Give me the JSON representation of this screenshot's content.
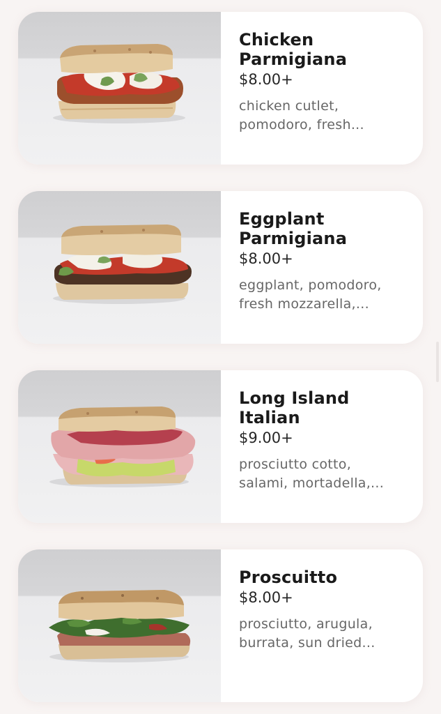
{
  "menu": {
    "items": [
      {
        "name": "Chicken Parmigiana",
        "name_lines": [
          "Chicken",
          "Parmigiana"
        ],
        "price": "$8.00+",
        "desc_lines": [
          "chicken cutlet,",
          "pomodoro, fresh..."
        ]
      },
      {
        "name": "Eggplant Parmigiana",
        "name_lines": [
          "Eggplant",
          "Parmigiana"
        ],
        "price": "$8.00+",
        "desc_lines": [
          "eggplant, pomodoro,",
          "fresh mozzarella,..."
        ]
      },
      {
        "name": "Long Island Italian",
        "name_lines": [
          "Long Island",
          "Italian"
        ],
        "price": "$9.00+",
        "desc_lines": [
          "prosciutto cotto,",
          "salami, mortadella,..."
        ]
      },
      {
        "name": "Proscuitto",
        "name_lines": [
          "Proscuitto"
        ],
        "price": "$8.00+",
        "desc_lines": [
          "prosciutto, arugula,",
          "burrata, sun dried..."
        ]
      }
    ]
  },
  "colors": {
    "page_background": "#f8f4f3",
    "card_background": "#ffffff",
    "title_text": "#1a1a1a",
    "description_text": "#666666"
  },
  "icons": {
    "item_photos": [
      "sandwich-chicken-parm-photo",
      "sandwich-eggplant-parm-photo",
      "sandwich-long-island-italian-photo",
      "sandwich-prosciutto-photo"
    ]
  }
}
